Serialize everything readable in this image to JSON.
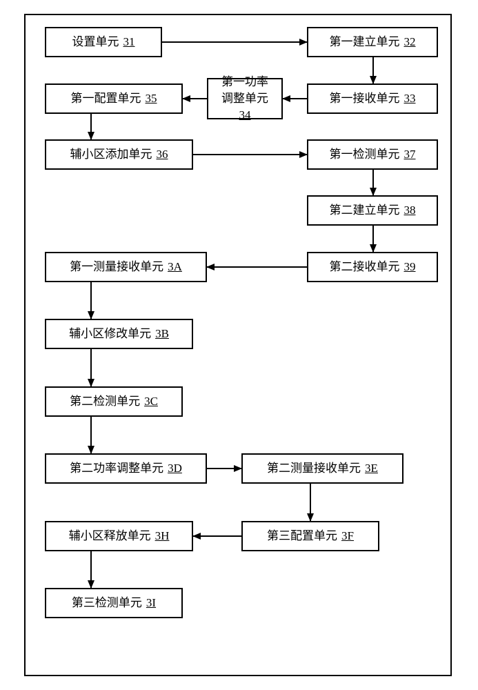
{
  "diagram": {
    "nodes": {
      "n31": {
        "label": "设置单元",
        "ref": "31"
      },
      "n32": {
        "label": "第一建立单元",
        "ref": "32"
      },
      "n33": {
        "label": "第一接收单元",
        "ref": "33"
      },
      "n34": {
        "label": "第一功率\n调整单元",
        "ref": "34"
      },
      "n35": {
        "label": "第一配置单元",
        "ref": "35"
      },
      "n36": {
        "label": "辅小区添加单元",
        "ref": "36"
      },
      "n37": {
        "label": "第一检测单元",
        "ref": "37"
      },
      "n38": {
        "label": "第二建立单元",
        "ref": "38"
      },
      "n39": {
        "label": "第二接收单元",
        "ref": "39"
      },
      "n3A": {
        "label": "第一测量接收单元",
        "ref": "3A"
      },
      "n3B": {
        "label": "辅小区修改单元",
        "ref": "3B"
      },
      "n3C": {
        "label": "第二检测单元",
        "ref": "3C"
      },
      "n3D": {
        "label": "第二功率调整单元",
        "ref": "3D"
      },
      "n3E": {
        "label": "第二测量接收单元",
        "ref": "3E"
      },
      "n3F": {
        "label": "第三配置单元",
        "ref": "3F"
      },
      "n3H": {
        "label": "辅小区释放单元",
        "ref": "3H"
      },
      "n3I": {
        "label": "第三检测单元",
        "ref": "3I"
      }
    },
    "edges": [
      {
        "from": "n31",
        "to": "n32"
      },
      {
        "from": "n32",
        "to": "n33"
      },
      {
        "from": "n33",
        "to": "n34"
      },
      {
        "from": "n34",
        "to": "n35"
      },
      {
        "from": "n35",
        "to": "n36"
      },
      {
        "from": "n36",
        "to": "n37"
      },
      {
        "from": "n37",
        "to": "n38"
      },
      {
        "from": "n38",
        "to": "n39"
      },
      {
        "from": "n39",
        "to": "n3A"
      },
      {
        "from": "n3A",
        "to": "n3B"
      },
      {
        "from": "n3B",
        "to": "n3C"
      },
      {
        "from": "n3C",
        "to": "n3D"
      },
      {
        "from": "n3D",
        "to": "n3E"
      },
      {
        "from": "n3E",
        "to": "n3F"
      },
      {
        "from": "n3F",
        "to": "n3H"
      },
      {
        "from": "n3H",
        "to": "n3I"
      }
    ]
  }
}
